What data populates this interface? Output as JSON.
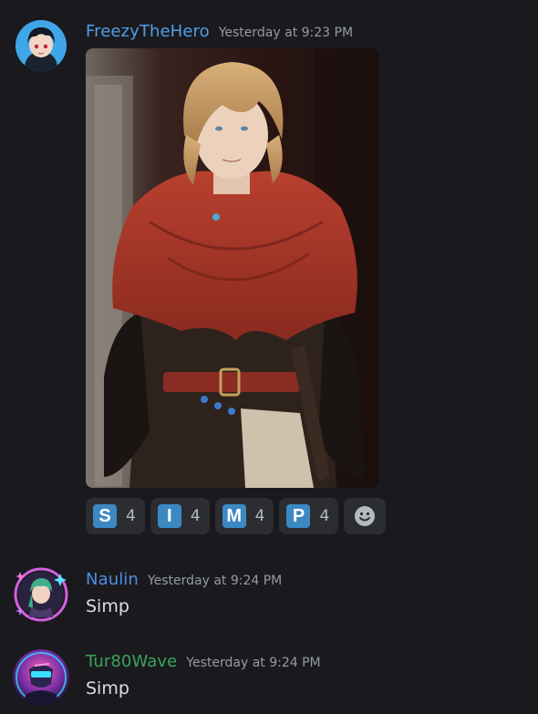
{
  "messages": [
    {
      "username": "FreezyTheHero",
      "timestamp": "Yesterday at 9:23 PM",
      "color": "#4f9ee8"
    },
    {
      "username": "Naulin",
      "timestamp": "Yesterday at 9:24 PM",
      "content": "Simp",
      "color": "#4f8fe0"
    },
    {
      "username": "Tur80Wave",
      "timestamp": "Yesterday at 9:24 PM",
      "content": "Simp",
      "color": "#3ba55d"
    }
  ],
  "reactions": [
    {
      "emoji": "S",
      "count": "4"
    },
    {
      "emoji": "I",
      "count": "4"
    },
    {
      "emoji": "M",
      "count": "4"
    },
    {
      "emoji": "P",
      "count": "4"
    }
  ],
  "icons": {
    "add_reaction": "smiley-face-icon"
  }
}
